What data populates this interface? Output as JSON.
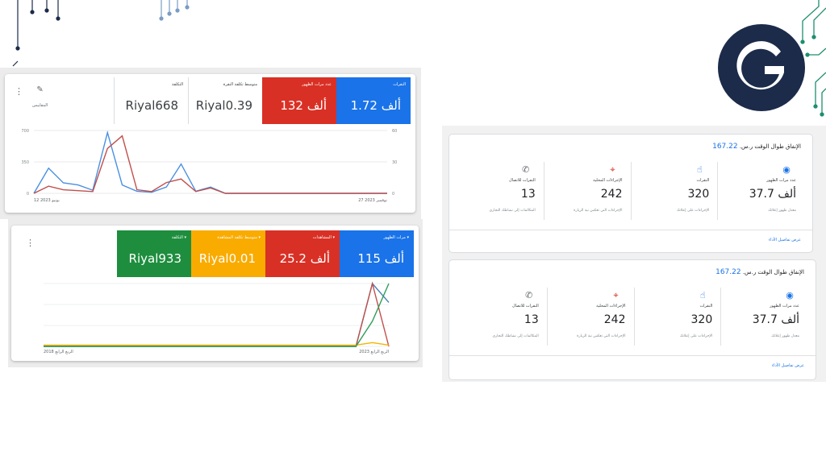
{
  "campaign_chart": {
    "metrics": [
      {
        "label": "النقرات",
        "value": "1.72 ألف",
        "color": "#1a73e8"
      },
      {
        "label": "عدد مرات الظهور",
        "value": "132 ألف",
        "color": "#d93025"
      },
      {
        "label": "متوسط تكلفة النقرة",
        "value": "Riyal0.39",
        "color": "#ffffff"
      },
      {
        "label": "التكلفة",
        "value": "Riyal668",
        "color": "#ffffff"
      }
    ],
    "tools_label": "المقاييس",
    "y_left_ticks": [
      "700",
      "350",
      "0"
    ],
    "y_right_ticks": [
      "60",
      "30",
      "0"
    ],
    "x_start": "12 يونيو 2023",
    "x_end": "27 نوفمبر 2023",
    "chart_data": {
      "type": "line",
      "series": [
        {
          "name": "النقرات",
          "color": "#4a90e2",
          "values": [
            0,
            24,
            10,
            8,
            3,
            58,
            8,
            2,
            1,
            6,
            28,
            2,
            6,
            0,
            0,
            0,
            0,
            0,
            0,
            0,
            0,
            0,
            0,
            0,
            0
          ]
        },
        {
          "name": "عدد مرات الظهور",
          "color": "#c0504d",
          "values": [
            0,
            80,
            40,
            30,
            20,
            500,
            640,
            40,
            20,
            120,
            160,
            20,
            60,
            0,
            0,
            0,
            0,
            0,
            0,
            0,
            0,
            0,
            0,
            0,
            0
          ]
        }
      ]
    }
  },
  "video_chart": {
    "metrics": [
      {
        "label": "مرات الظهور",
        "value": "115 ألف",
        "color": "#1a73e8"
      },
      {
        "label": "المشاهدات",
        "value": "25.2 ألف",
        "color": "#d93025"
      },
      {
        "label": "متوسط تكلفة المشاهدة",
        "value": "Riyal0.01",
        "color": "#f9ab00"
      },
      {
        "label": "التكلفة",
        "value": "Riyal933",
        "color": "#1e8e3e"
      }
    ],
    "x_start": "الربع الرابع 2018",
    "x_end": "الربع الرابع 2023",
    "chart_data": {
      "type": "line",
      "series": [
        {
          "name": "مرات الظهور",
          "color": "#4a7fb5",
          "values": [
            0,
            0,
            0,
            0,
            0,
            0,
            0,
            0,
            0,
            0,
            0,
            0,
            0,
            0,
            0,
            0,
            0,
            0,
            0,
            0,
            100,
            70
          ]
        },
        {
          "name": "المشاهدات",
          "color": "#c0504d",
          "values": [
            0,
            0,
            0,
            0,
            0,
            0,
            0,
            0,
            0,
            0,
            0,
            0,
            0,
            0,
            0,
            0,
            0,
            0,
            0,
            0,
            100,
            0
          ]
        },
        {
          "name": "متوسط تكلفة المشاهدة",
          "color": "#f4b400",
          "values": [
            2,
            2,
            2,
            2,
            2,
            2,
            2,
            2,
            2,
            2,
            2,
            2,
            2,
            2,
            2,
            2,
            2,
            2,
            2,
            2,
            6,
            2
          ]
        },
        {
          "name": "التكلفة",
          "color": "#2e9e5a",
          "values": [
            0,
            0,
            0,
            0,
            0,
            0,
            0,
            0,
            0,
            0,
            0,
            0,
            0,
            0,
            0,
            0,
            0,
            0,
            0,
            0,
            40,
            100
          ]
        }
      ]
    }
  },
  "panels": [
    {
      "title_amount": "167.22",
      "title_currency": "ر.س.",
      "title_text": "الإنفاق طوال الوقت",
      "columns": [
        {
          "icon": "eye-icon",
          "label": "عدد مرات الظهور",
          "value": "37.7 ألف",
          "sub": "معدل ظهور إعلانك"
        },
        {
          "icon": "tap-icon",
          "label": "النقرات",
          "value": "320",
          "sub": "الإجراءات على إعلانك"
        },
        {
          "icon": "location-pin-icon",
          "label": "الإجراءات المحلية",
          "value": "242",
          "sub": "الإجراءات التي تعكس نية الزيارة"
        },
        {
          "icon": "phone-icon",
          "label": "النقرات للاتصال",
          "value": "13",
          "sub": "المكالمات إلى نشاطك التجاري"
        }
      ],
      "link": "عرض تفاصيل الأداء"
    },
    {
      "title_amount": "167.22",
      "title_currency": "ر.س.",
      "title_text": "الإنفاق طوال الوقت",
      "columns": [
        {
          "icon": "eye-icon",
          "label": "عدد مرات الظهور",
          "value": "37.7 ألف",
          "sub": "معدل ظهور إعلانك"
        },
        {
          "icon": "tap-icon",
          "label": "النقرات",
          "value": "320",
          "sub": "الإجراءات على إعلانك"
        },
        {
          "icon": "location-pin-icon",
          "label": "الإجراءات المحلية",
          "value": "242",
          "sub": "الإجراءات التي تعكس نية الزيارة"
        },
        {
          "icon": "phone-icon",
          "label": "النقرات للاتصال",
          "value": "13",
          "sub": "المكالمات إلى نشاطك التجاري"
        }
      ],
      "link": "عرض تفاصيل الأداء"
    }
  ],
  "colors": {
    "brand_navy": "#1c2b4a",
    "accent_green": "#1e8e6e"
  }
}
